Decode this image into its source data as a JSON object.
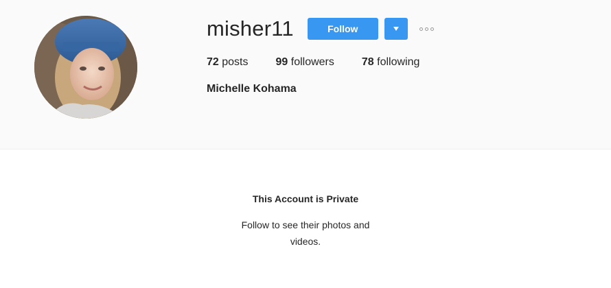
{
  "profile": {
    "username": "misher11",
    "full_name": "Michelle Kohama",
    "follow_label": "Follow",
    "stats": [
      {
        "count": "72",
        "label": "posts"
      },
      {
        "count": "99",
        "label": "followers"
      },
      {
        "count": "78",
        "label": "following"
      }
    ]
  },
  "private_notice": {
    "title": "This Account is Private",
    "message": "Follow to see their photos and videos."
  },
  "icons": {
    "dropdown": "caret-down-icon",
    "more": "more-options-icon"
  },
  "colors": {
    "accent": "#3897f0",
    "header_bg": "#fafafa",
    "text": "#262626"
  }
}
